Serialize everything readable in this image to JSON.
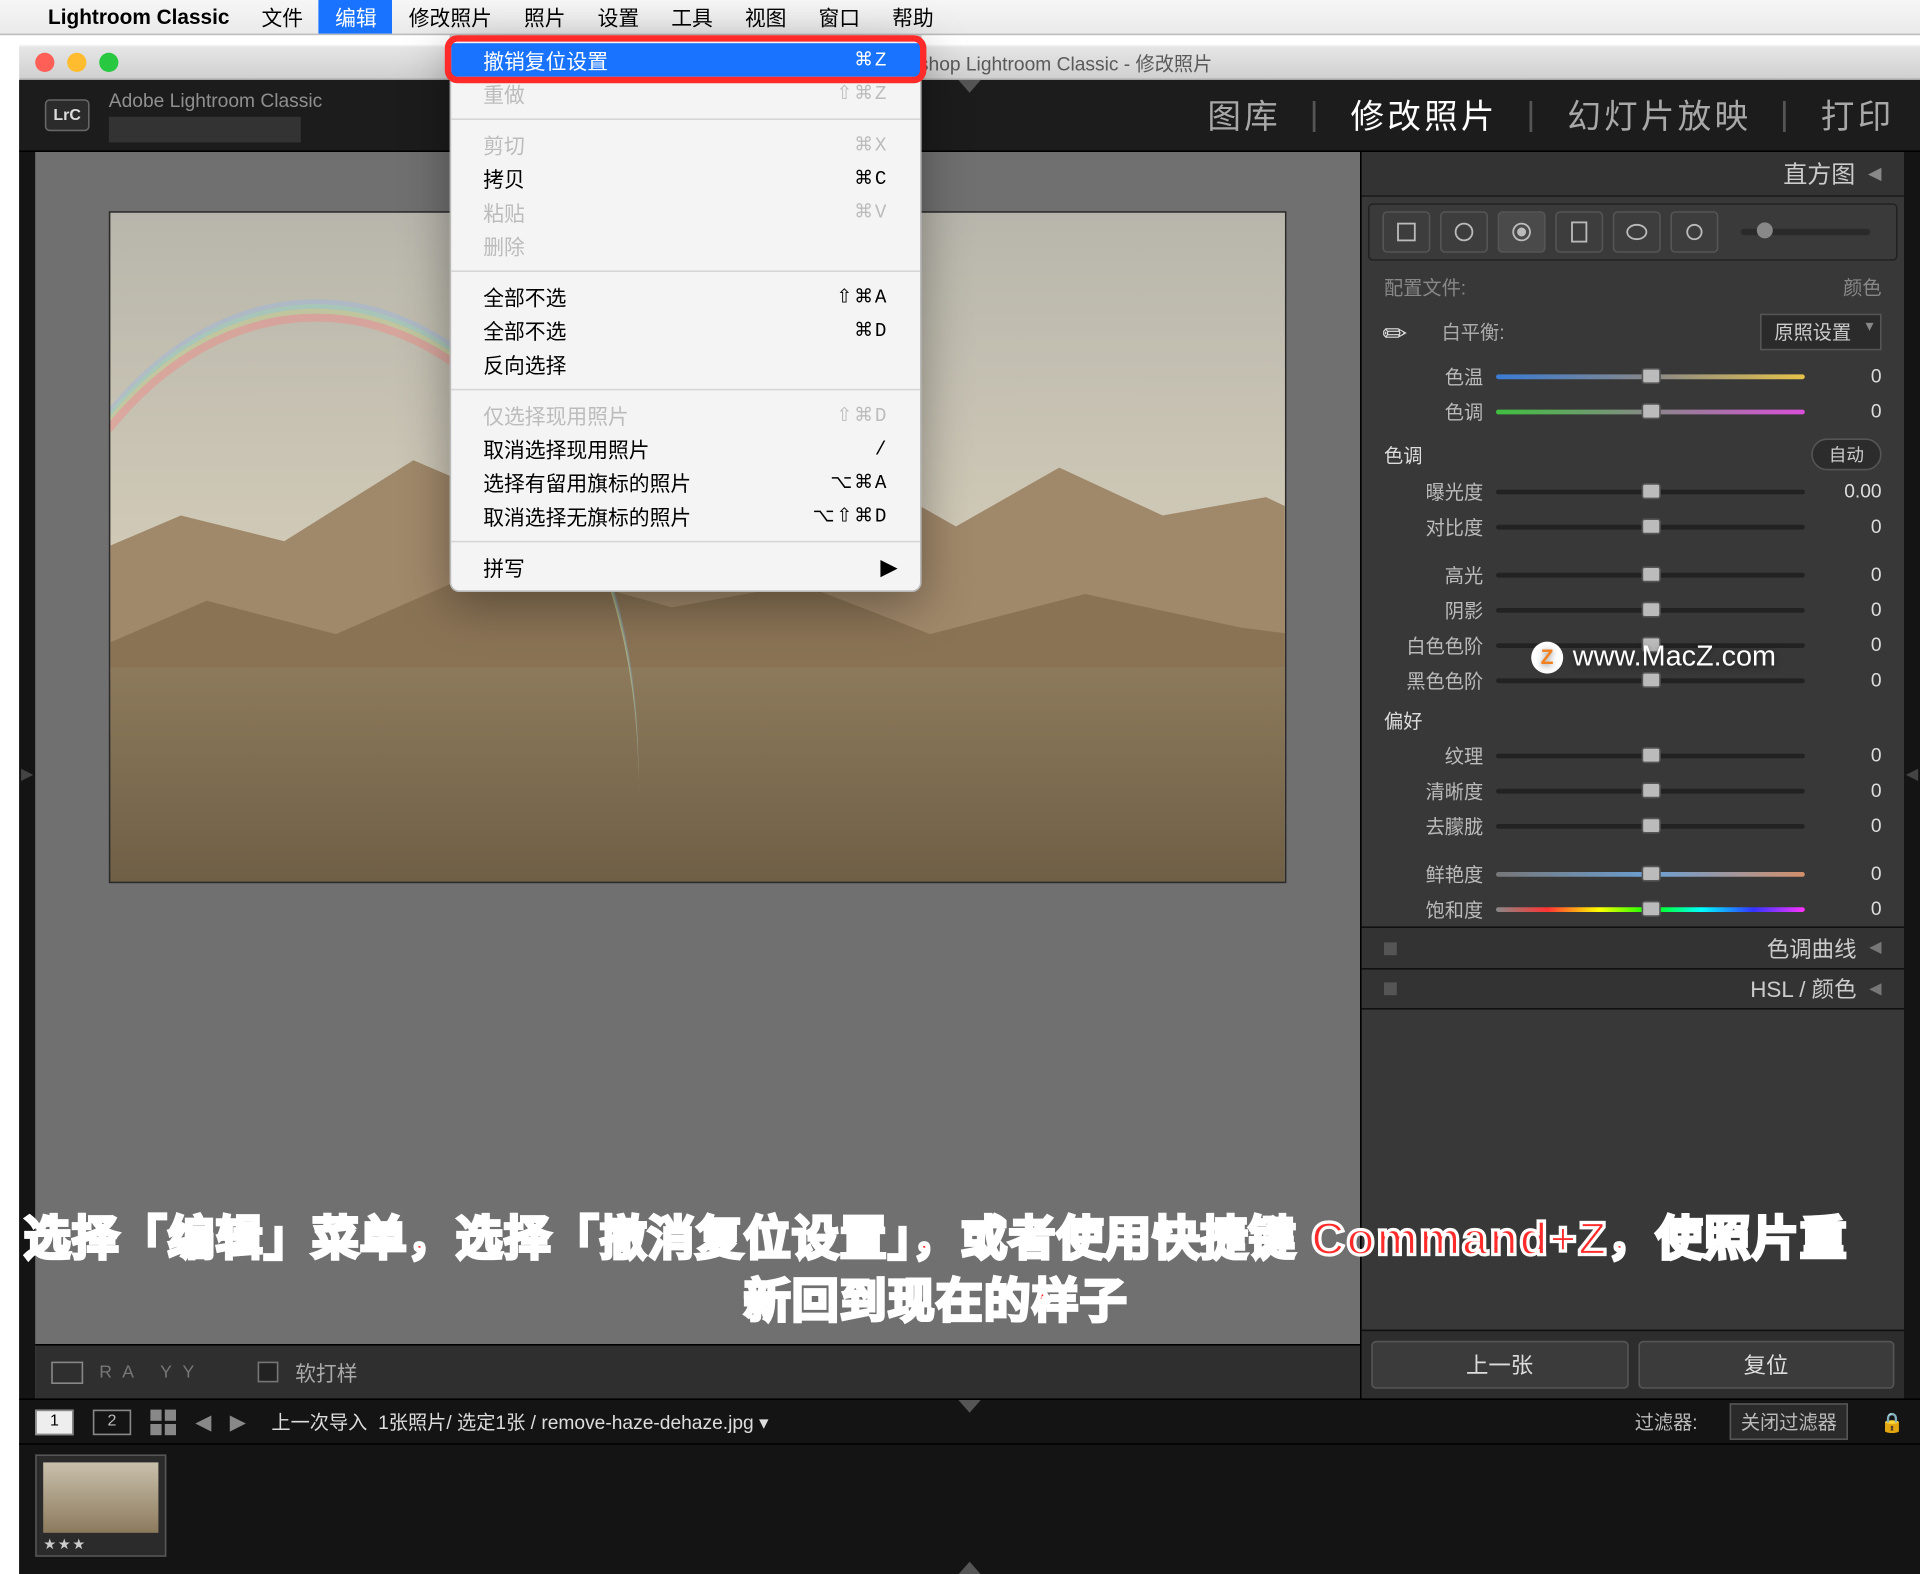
{
  "mac_menubar": {
    "app": "Lightroom Classic",
    "items": [
      "文件",
      "编辑",
      "修改照片",
      "照片",
      "设置",
      "工具",
      "视图",
      "窗口",
      "帮助"
    ],
    "active_index": 1
  },
  "window_title": "be Photoshop Lightroom Classic - 修改照片",
  "dropdown": [
    {
      "label": "撤销复位设置",
      "shortcut": "⌘Z",
      "hi": true
    },
    {
      "label": "重做",
      "shortcut": "⇧⌘Z",
      "dis": true
    },
    {
      "sep": true
    },
    {
      "label": "剪切",
      "shortcut": "⌘X",
      "dis": true
    },
    {
      "label": "拷贝",
      "shortcut": "⌘C"
    },
    {
      "label": "粘贴",
      "shortcut": "⌘V",
      "dis": true
    },
    {
      "label": "删除",
      "dis": true
    },
    {
      "sep": true
    },
    {
      "label": "全部不选",
      "shortcut": "⇧⌘A"
    },
    {
      "label": "全部不选",
      "shortcut": "⌘D"
    },
    {
      "label": "反向选择"
    },
    {
      "sep": true
    },
    {
      "label": "仅选择现用照片",
      "shortcut": "⇧⌘D",
      "dis": true
    },
    {
      "label": "取消选择现用照片",
      "shortcut": "/"
    },
    {
      "label": "选择有留用旗标的照片",
      "shortcut": "⌥⌘A"
    },
    {
      "label": "取消选择无旗标的照片",
      "shortcut": "⌥⇧⌘D"
    },
    {
      "sep": true
    },
    {
      "label": "拼写",
      "submenu": true
    }
  ],
  "brand": {
    "badge": "LrC",
    "name": "Adobe Lightroom Classic"
  },
  "modules": {
    "items": [
      "图库",
      "修改照片",
      "幻灯片放映",
      "打印"
    ],
    "active": 1
  },
  "right_panel": {
    "histogram": "直方图",
    "preset_row": {
      "left": "配置文件:",
      "value": "颜色"
    },
    "wb": {
      "label": "白平衡:",
      "value": "原照设置"
    },
    "temp": {
      "label": "色温",
      "value": "0"
    },
    "tint": {
      "label": "色调",
      "value": "0"
    },
    "tone_head": "色调",
    "auto": "自动",
    "exposure": {
      "label": "曝光度",
      "value": "0.00"
    },
    "contrast": {
      "label": "对比度",
      "value": "0"
    },
    "highlights": {
      "label": "高光",
      "value": "0"
    },
    "shadows": {
      "label": "阴影",
      "value": "0"
    },
    "whites": {
      "label": "白色色阶",
      "value": "0"
    },
    "blacks": {
      "label": "黑色色阶",
      "value": "0"
    },
    "presence": "偏好",
    "texture": {
      "label": "纹理",
      "value": "0"
    },
    "clarity": {
      "label": "清晰度",
      "value": "0"
    },
    "dehaze": {
      "label": "去朦胧",
      "value": "0"
    },
    "vibrance": {
      "label": "鲜艳度",
      "value": "0"
    },
    "saturation": {
      "label": "饱和度",
      "value": "0"
    },
    "tone_curve": "色调曲线",
    "hsl": "HSL / 颜色",
    "prev": "上一张",
    "reset": "复位"
  },
  "toolbar": {
    "soft_proof": "软打样"
  },
  "filmstrip": {
    "path_prefix": "上一次导入",
    "count": "1张照片/ 选定1张 /",
    "file": "remove-haze-dehaze.jpg",
    "filter_label": "过滤器:",
    "filter_value": "关闭过滤器",
    "mon1": "1",
    "mon2": "2"
  },
  "watermark": "www.MacZ.com",
  "instruction": "选择「编辑」菜单，选择「撤消复位设置」，或者使用快捷键 Command+Z，使照片重新回到现在的样子"
}
